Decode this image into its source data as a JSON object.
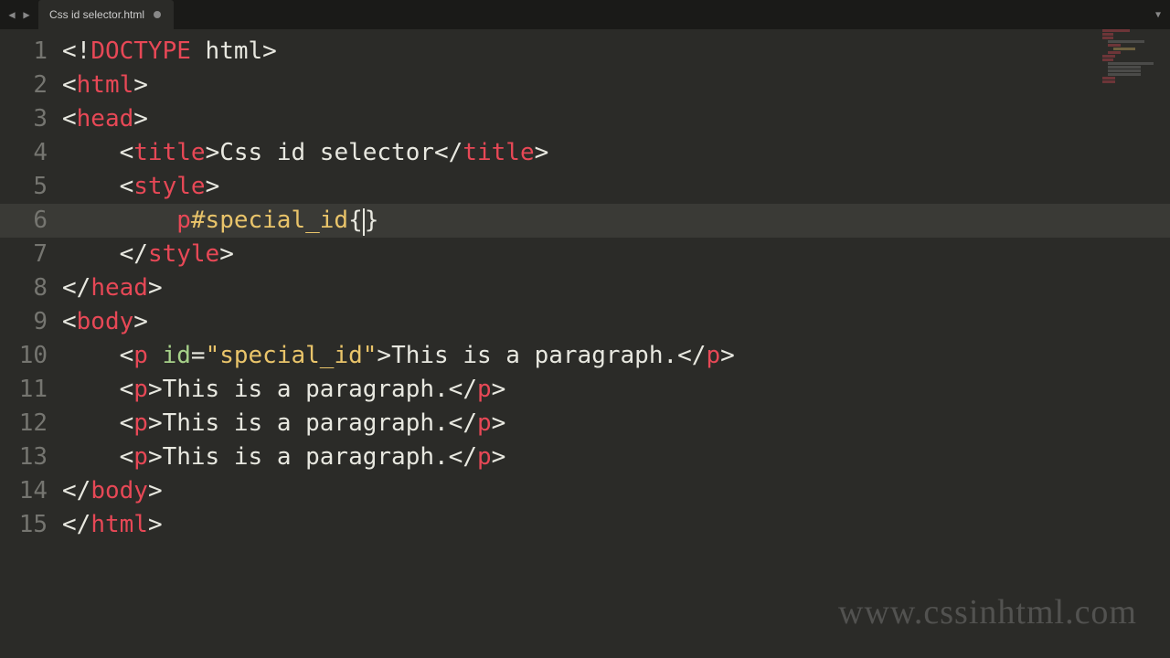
{
  "tab": {
    "title": "Css id selector.html"
  },
  "active_line": 6,
  "lines": [
    {
      "n": 1,
      "indent": 0,
      "tokens": [
        {
          "t": "<!",
          "c": "punct"
        },
        {
          "t": "DOCTYPE",
          "c": "doctype"
        },
        {
          "t": " html",
          "c": "text"
        },
        {
          "t": ">",
          "c": "punct"
        }
      ]
    },
    {
      "n": 2,
      "indent": 0,
      "tokens": [
        {
          "t": "<",
          "c": "punct"
        },
        {
          "t": "html",
          "c": "tag"
        },
        {
          "t": ">",
          "c": "punct"
        }
      ]
    },
    {
      "n": 3,
      "indent": 0,
      "tokens": [
        {
          "t": "<",
          "c": "punct"
        },
        {
          "t": "head",
          "c": "tag"
        },
        {
          "t": ">",
          "c": "punct"
        }
      ]
    },
    {
      "n": 4,
      "indent": 1,
      "tokens": [
        {
          "t": "<",
          "c": "punct"
        },
        {
          "t": "title",
          "c": "tag"
        },
        {
          "t": ">",
          "c": "punct"
        },
        {
          "t": "Css id selector",
          "c": "text"
        },
        {
          "t": "</",
          "c": "punct"
        },
        {
          "t": "title",
          "c": "tag"
        },
        {
          "t": ">",
          "c": "punct"
        }
      ]
    },
    {
      "n": 5,
      "indent": 1,
      "tokens": [
        {
          "t": "<",
          "c": "punct"
        },
        {
          "t": "style",
          "c": "tag"
        },
        {
          "t": ">",
          "c": "punct"
        }
      ]
    },
    {
      "n": 6,
      "indent": 2,
      "tokens": [
        {
          "t": "p",
          "c": "selector-tag"
        },
        {
          "t": "#special_id",
          "c": "selector-id"
        },
        {
          "t": "{",
          "c": "punct"
        },
        {
          "t": "CURSOR",
          "c": "cursor"
        },
        {
          "t": "}",
          "c": "punct"
        }
      ]
    },
    {
      "n": 7,
      "indent": 1,
      "tokens": [
        {
          "t": "</",
          "c": "punct"
        },
        {
          "t": "style",
          "c": "tag"
        },
        {
          "t": ">",
          "c": "punct"
        }
      ]
    },
    {
      "n": 8,
      "indent": 0,
      "tokens": [
        {
          "t": "</",
          "c": "punct"
        },
        {
          "t": "head",
          "c": "tag"
        },
        {
          "t": ">",
          "c": "punct"
        }
      ]
    },
    {
      "n": 9,
      "indent": 0,
      "tokens": [
        {
          "t": "<",
          "c": "punct"
        },
        {
          "t": "body",
          "c": "tag"
        },
        {
          "t": ">",
          "c": "punct"
        }
      ]
    },
    {
      "n": 10,
      "indent": 1,
      "tokens": [
        {
          "t": "<",
          "c": "punct"
        },
        {
          "t": "p",
          "c": "tag"
        },
        {
          "t": " ",
          "c": "text"
        },
        {
          "t": "id",
          "c": "attr"
        },
        {
          "t": "=",
          "c": "punct"
        },
        {
          "t": "\"special_id\"",
          "c": "string"
        },
        {
          "t": ">",
          "c": "punct"
        },
        {
          "t": "This is a paragraph.",
          "c": "text"
        },
        {
          "t": "</",
          "c": "punct"
        },
        {
          "t": "p",
          "c": "tag"
        },
        {
          "t": ">",
          "c": "punct"
        }
      ]
    },
    {
      "n": 11,
      "indent": 1,
      "tokens": [
        {
          "t": "<",
          "c": "punct"
        },
        {
          "t": "p",
          "c": "tag"
        },
        {
          "t": ">",
          "c": "punct"
        },
        {
          "t": "This is a paragraph.",
          "c": "text"
        },
        {
          "t": "</",
          "c": "punct"
        },
        {
          "t": "p",
          "c": "tag"
        },
        {
          "t": ">",
          "c": "punct"
        }
      ]
    },
    {
      "n": 12,
      "indent": 1,
      "tokens": [
        {
          "t": "<",
          "c": "punct"
        },
        {
          "t": "p",
          "c": "tag"
        },
        {
          "t": ">",
          "c": "punct"
        },
        {
          "t": "This is a paragraph.",
          "c": "text"
        },
        {
          "t": "</",
          "c": "punct"
        },
        {
          "t": "p",
          "c": "tag"
        },
        {
          "t": ">",
          "c": "punct"
        }
      ]
    },
    {
      "n": 13,
      "indent": 1,
      "tokens": [
        {
          "t": "<",
          "c": "punct"
        },
        {
          "t": "p",
          "c": "tag"
        },
        {
          "t": ">",
          "c": "punct"
        },
        {
          "t": "This is a paragraph.",
          "c": "text"
        },
        {
          "t": "</",
          "c": "punct"
        },
        {
          "t": "p",
          "c": "tag"
        },
        {
          "t": ">",
          "c": "punct"
        }
      ]
    },
    {
      "n": 14,
      "indent": 0,
      "tokens": [
        {
          "t": "</",
          "c": "punct"
        },
        {
          "t": "body",
          "c": "tag"
        },
        {
          "t": ">",
          "c": "punct"
        }
      ]
    },
    {
      "n": 15,
      "indent": 0,
      "tokens": [
        {
          "t": "</",
          "c": "punct"
        },
        {
          "t": "html",
          "c": "tag"
        },
        {
          "t": ">",
          "c": "punct"
        }
      ]
    }
  ],
  "watermark": "www.cssinhtml.com"
}
